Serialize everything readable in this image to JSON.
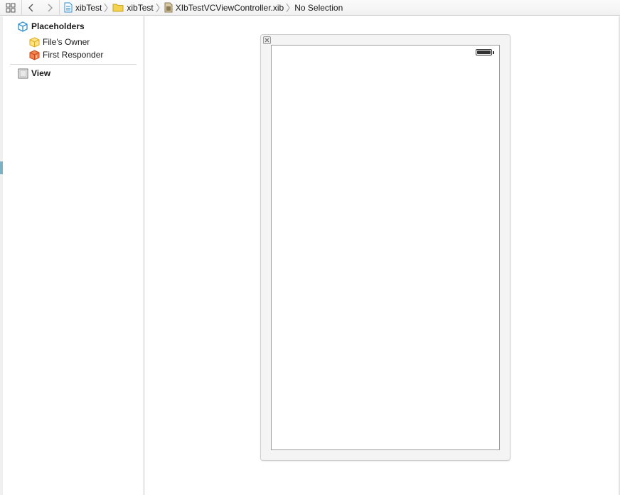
{
  "jumpbar": {
    "crumbs": [
      {
        "label": "xibTest",
        "icon": "project-file-icon"
      },
      {
        "label": "xibTest",
        "icon": "folder-icon"
      },
      {
        "label": "XIbTestVCViewController.xib",
        "icon": "xib-file-icon"
      },
      {
        "label": "No Selection",
        "icon": ""
      }
    ]
  },
  "outline": {
    "placeholders_label": "Placeholders",
    "files_owner_label": "File's Owner",
    "first_responder_label": "First Responder",
    "view_label": "View"
  },
  "colors": {
    "accent_teal": "#7bb1c4",
    "placeholder_blue": "#2f8fd0",
    "files_owner_yellow": "#f2c230",
    "first_responder_orange": "#e8622b"
  }
}
